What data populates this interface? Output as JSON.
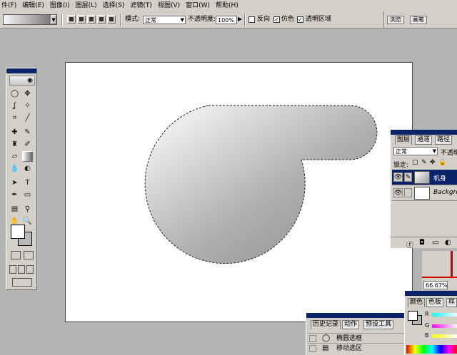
{
  "menubar": {
    "items": [
      "件(F)",
      "编辑(E)",
      "图像(I)",
      "图层(L)",
      "选择(S)",
      "滤镜(T)",
      "视图(V)",
      "窗口(W)",
      "帮助(H)"
    ]
  },
  "options": {
    "mode_label": "模式:",
    "mode_value": "正常",
    "opacity_label": "不透明度:",
    "opacity_value": "100%",
    "reverse_label": "反向",
    "reverse_checked": false,
    "dither_label": "仿色",
    "dither_checked": true,
    "transparency_label": "透明区域",
    "transparency_checked": true,
    "well_tabs": [
      "浏览",
      "画笔"
    ]
  },
  "layers_panel": {
    "tabs": [
      "图层",
      "通道",
      "路径"
    ],
    "blend_mode": "正常",
    "opacity_label": "不透明",
    "lock_label": "锁定:",
    "layers": [
      {
        "name": "机身",
        "selected": true
      },
      {
        "name": "Background",
        "selected": false
      }
    ]
  },
  "navigator": {
    "zoom": "66.67%"
  },
  "history_panel": {
    "tabs": [
      "历史记录",
      "动作",
      "预设工具"
    ],
    "items": [
      {
        "label": "椭圆选框",
        "icon": "ellipse-select-icon"
      },
      {
        "label": "移动选区",
        "icon": "move-selection-icon"
      }
    ]
  },
  "color_panel": {
    "tabs": [
      "颜色",
      "色板",
      "样"
    ],
    "channels": [
      "R",
      "G",
      "B"
    ]
  },
  "colors": {
    "ui_gray": "#d4d0c8",
    "workspace": "#b4b4b4",
    "title_blue": "#0a246a"
  }
}
